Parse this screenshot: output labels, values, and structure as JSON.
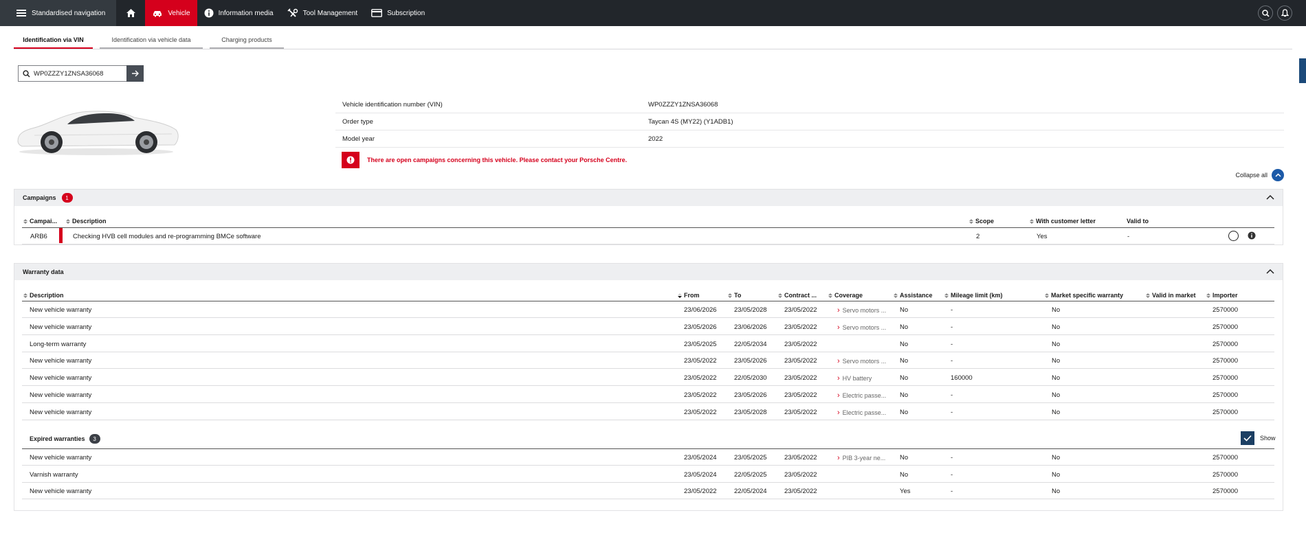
{
  "topbar": {
    "nav_label": "Standardised navigation",
    "items": [
      {
        "label": "Vehicle",
        "icon": "car-icon",
        "active": true
      },
      {
        "label": "Information media",
        "icon": "info-icon"
      },
      {
        "label": "Tool Management",
        "icon": "tools-icon"
      },
      {
        "label": "Subscription",
        "icon": "card-icon"
      }
    ]
  },
  "tabs": [
    "Identification via VIN",
    "Identification via vehicle data",
    "Charging products"
  ],
  "search": {
    "value": "WP0ZZZY1ZNSA36068"
  },
  "vehicle": {
    "rows": [
      {
        "key": "Vehicle identification number (VIN)",
        "value": "WP0ZZZY1ZNSA36068"
      },
      {
        "key": "Order type",
        "value": "Taycan 4S (MY22) (Y1ADB1)"
      },
      {
        "key": "Model year",
        "value": "2022"
      }
    ],
    "alert": "There are open campaigns concerning this vehicle. Please contact your Porsche Centre."
  },
  "collapse_all": "Collapse all",
  "campaigns": {
    "title": "Campaigns",
    "count": "1",
    "headers": [
      "Campai...",
      "Description",
      "Scope",
      "With customer letter",
      "Valid to"
    ],
    "rows": [
      {
        "code": "ARB6",
        "description": "Checking HVB cell modules and re-programming BMCe software",
        "scope": "2",
        "letter": "Yes",
        "valid_to": "-"
      }
    ]
  },
  "warranty": {
    "title": "Warranty data",
    "headers": [
      "Description",
      "From",
      "To",
      "Contract ...",
      "Coverage",
      "Assistance",
      "Mileage limit (km)",
      "Market specific warranty",
      "Valid in market",
      "Importer"
    ],
    "rows": [
      {
        "desc": "New vehicle warranty",
        "from": "23/06/2026",
        "to": "23/05/2028",
        "contract": "23/05/2022",
        "coverage": "Servo motors ...",
        "assist": "No",
        "mileage": "-",
        "market": "No",
        "importer": "2570000"
      },
      {
        "desc": "New vehicle warranty",
        "from": "23/05/2026",
        "to": "23/06/2026",
        "contract": "23/05/2022",
        "coverage": "Servo motors ...",
        "assist": "No",
        "mileage": "-",
        "market": "No",
        "importer": "2570000"
      },
      {
        "desc": "Long-term warranty",
        "from": "23/05/2025",
        "to": "22/05/2034",
        "contract": "23/05/2022",
        "coverage": "",
        "assist": "No",
        "mileage": "-",
        "market": "No",
        "importer": "2570000"
      },
      {
        "desc": "New vehicle warranty",
        "from": "23/05/2022",
        "to": "23/05/2026",
        "contract": "23/05/2022",
        "coverage": "Servo motors ...",
        "assist": "No",
        "mileage": "-",
        "market": "No",
        "importer": "2570000"
      },
      {
        "desc": "New vehicle warranty",
        "from": "23/05/2022",
        "to": "22/05/2030",
        "contract": "23/05/2022",
        "coverage": "HV battery",
        "assist": "No",
        "mileage": "160000",
        "market": "No",
        "importer": "2570000"
      },
      {
        "desc": "New vehicle warranty",
        "from": "23/05/2022",
        "to": "23/05/2026",
        "contract": "23/05/2022",
        "coverage": "Electric passe...",
        "assist": "No",
        "mileage": "-",
        "market": "No",
        "importer": "2570000"
      },
      {
        "desc": "New vehicle warranty",
        "from": "23/05/2022",
        "to": "23/05/2028",
        "contract": "23/05/2022",
        "coverage": "Electric passe...",
        "assist": "No",
        "mileage": "-",
        "market": "No",
        "importer": "2570000"
      }
    ],
    "expired": {
      "title": "Expired warranties",
      "count": "3",
      "show_label": "Show",
      "rows": [
        {
          "desc": "New vehicle warranty",
          "from": "23/05/2024",
          "to": "23/05/2025",
          "contract": "23/05/2022",
          "coverage": "PIB 3-year ne...",
          "assist": "No",
          "mileage": "-",
          "market": "No",
          "importer": "2570000"
        },
        {
          "desc": "Varnish warranty",
          "from": "23/05/2024",
          "to": "22/05/2025",
          "contract": "23/05/2022",
          "coverage": "",
          "assist": "No",
          "mileage": "-",
          "market": "No",
          "importer": "2570000"
        },
        {
          "desc": "New vehicle warranty",
          "from": "23/05/2022",
          "to": "22/05/2024",
          "contract": "23/05/2022",
          "coverage": "",
          "assist": "Yes",
          "mileage": "-",
          "market": "No",
          "importer": "2570000"
        }
      ]
    }
  },
  "colors": {
    "accent": "#d5001c",
    "topbar": "#22262b",
    "blue": "#1c5aa8"
  }
}
